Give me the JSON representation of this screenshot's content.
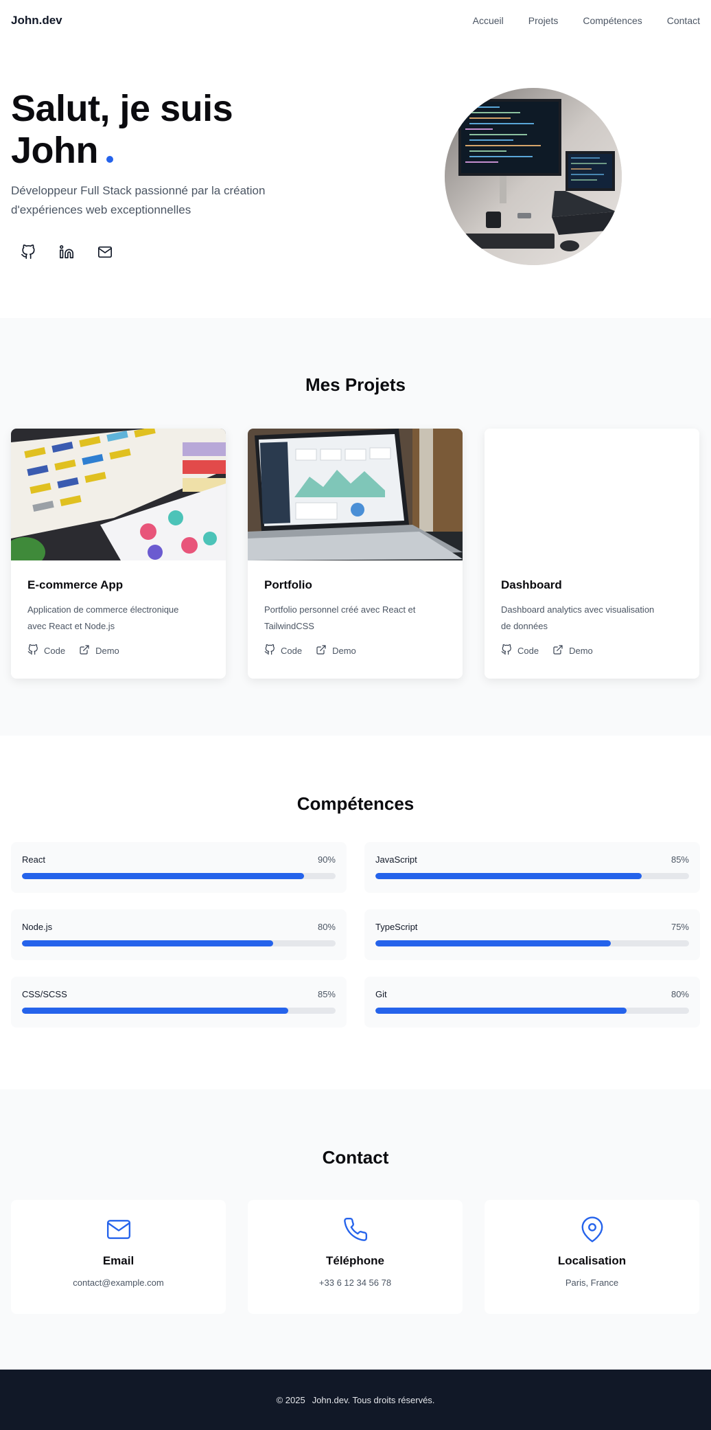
{
  "nav": {
    "logo": "John.dev",
    "links": [
      "Accueil",
      "Projets",
      "Compétences",
      "Contact"
    ]
  },
  "hero": {
    "title_line1": "Salut, je suis",
    "title_line2": "John",
    "subtitle": "Développeur Full Stack passionné par la création d'expériences web exceptionnelles",
    "socials": [
      "github-icon",
      "linkedin-icon",
      "mail-icon"
    ]
  },
  "projects": {
    "title": "Mes Projets",
    "items": [
      {
        "title": "E-commerce App",
        "description": "Application de commerce électronique avec React et Node.js",
        "code_label": "Code",
        "demo_label": "Demo"
      },
      {
        "title": "Portfolio",
        "description": "Portfolio personnel créé avec React et TailwindCSS",
        "code_label": "Code",
        "demo_label": "Demo"
      },
      {
        "title": "Dashboard",
        "description": "Dashboard analytics avec visualisation de données",
        "code_label": "Code",
        "demo_label": "Demo"
      }
    ]
  },
  "skills": {
    "title": "Compétences",
    "items": [
      {
        "name": "React",
        "pct_label": "90%",
        "value": 90
      },
      {
        "name": "JavaScript",
        "pct_label": "85%",
        "value": 85
      },
      {
        "name": "Node.js",
        "pct_label": "80%",
        "value": 80
      },
      {
        "name": "TypeScript",
        "pct_label": "75%",
        "value": 75
      },
      {
        "name": "CSS/SCSS",
        "pct_label": "85%",
        "value": 85
      },
      {
        "name": "Git",
        "pct_label": "80%",
        "value": 80
      }
    ]
  },
  "contact": {
    "title": "Contact",
    "items": [
      {
        "title": "Email",
        "value": "contact@example.com",
        "icon": "mail-icon"
      },
      {
        "title": "Téléphone",
        "value": "+33 6 12 34 56 78",
        "icon": "phone-icon"
      },
      {
        "title": "Localisation",
        "value": "Paris, France",
        "icon": "map-pin-icon"
      }
    ]
  },
  "footer": {
    "copyright": "© 2025",
    "text": "John.dev. Tous droits réservés."
  },
  "colors": {
    "accent": "#2563eb",
    "footer_bg": "#111827",
    "section_bg": "#f9fafb"
  }
}
